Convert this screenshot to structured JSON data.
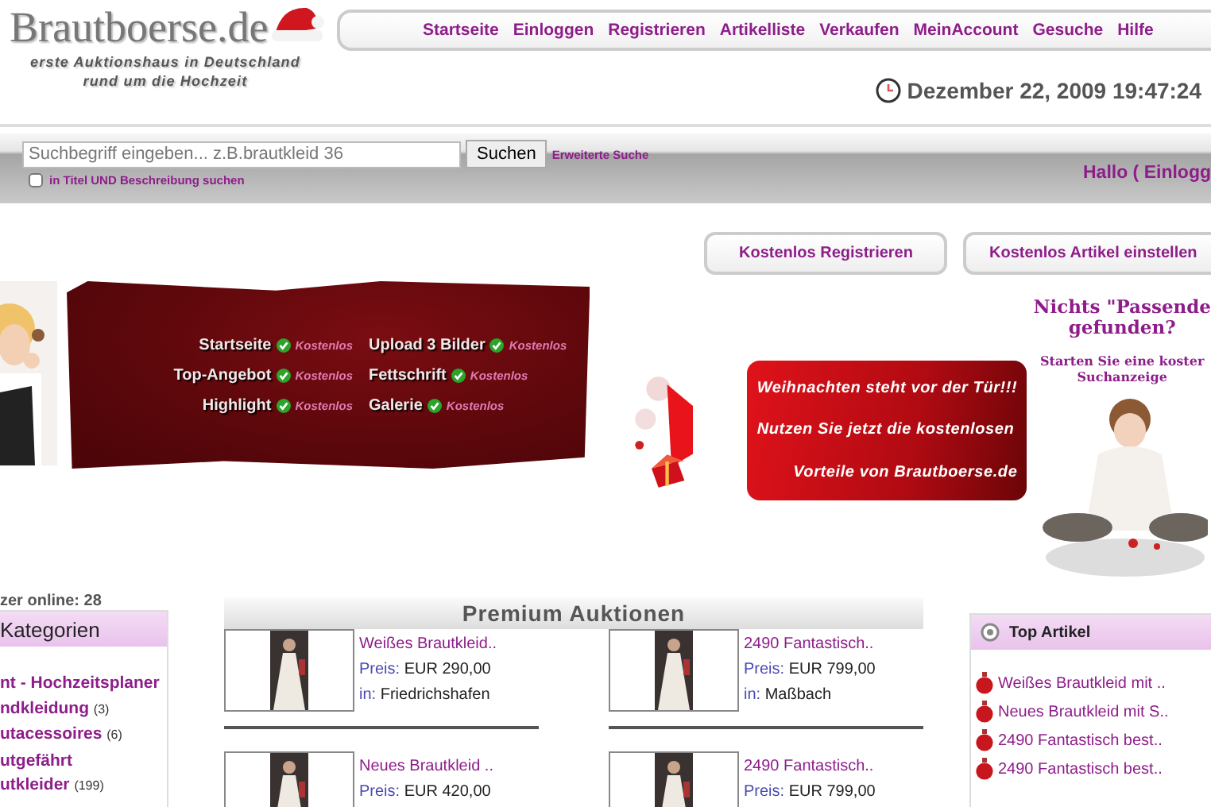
{
  "logo": {
    "title": "Brautboerse.de",
    "tagline": [
      "erste Auktionshaus in Deutschland",
      "rund um die Hochzeit"
    ]
  },
  "nav": [
    {
      "label": "Startseite"
    },
    {
      "label": "Einloggen"
    },
    {
      "label": "Registrieren"
    },
    {
      "label": "Artikelliste"
    },
    {
      "label": "Verkaufen"
    },
    {
      "label": "MeinAccount"
    },
    {
      "label": "Gesuche"
    },
    {
      "label": "Hilfe"
    }
  ],
  "datetime": "Dezember 22, 2009 19:47:24",
  "search": {
    "placeholder": "Suchbegriff eingeben... z.B.brautkleid 36",
    "button": "Suchen",
    "advanced_link": "Erweiterte Suche",
    "option": {
      "label": "in Titel UND Beschreibung suchen",
      "checked": false
    }
  },
  "greeting": "Hallo ( Einlogg",
  "action_buttons": [
    "Kostenlos Registrieren",
    "Kostenlos Artikel einstellen"
  ],
  "promo_banner": {
    "features": [
      {
        "label": "Startseite",
        "badge": "Kostenlos"
      },
      {
        "label": "Upload 3 Bilder",
        "badge": "Kostenlos"
      },
      {
        "label": "Top-Angebot",
        "badge": "Kostenlos"
      },
      {
        "label": "Fettschrift",
        "badge": "Kostenlos"
      },
      {
        "label": "Highlight",
        "badge": "Kostenlos"
      },
      {
        "label": "Galerie",
        "badge": "Kostenlos"
      }
    ]
  },
  "christmas_banner": {
    "lines": [
      "Weihnachten steht vor der Tür!!!",
      "Nutzen Sie jetzt die kostenlosen",
      "Vorteile von Brautboerse.de"
    ]
  },
  "search_request": {
    "heading": [
      "Nichts \"Passende",
      "gefunden?"
    ],
    "text": [
      "Starten Sie eine koster",
      "Suchanzeige"
    ]
  },
  "users_online": "zer online: 28",
  "categories": {
    "title": "Kategorien",
    "items": [
      {
        "name": "nt - Hochzeitsplaner"
      },
      {
        "name": "ndkleidung",
        "count": "(3)"
      },
      {
        "name": "utacessoires",
        "count": "(6)"
      },
      {
        "name": "utgefährt"
      },
      {
        "name": "utkleider",
        "count": "(199)"
      }
    ]
  },
  "premium": {
    "title": "Premium Auktionen",
    "items": [
      {
        "title": "Weißes Brautkleid..",
        "price_label": "Preis:",
        "price": "EUR 290,00",
        "location_label": "in:",
        "location": "Friedrichshafen"
      },
      {
        "title": "2490 Fantastisch..",
        "price_label": "Preis:",
        "price": "EUR 799,00",
        "location_label": "in:",
        "location": "Maßbach"
      },
      {
        "title": "Neues Brautkleid ..",
        "price_label": "Preis:",
        "price": "EUR 420,00"
      },
      {
        "title": "2490 Fantastisch..",
        "price_label": "Preis:",
        "price": "EUR 799,00"
      }
    ]
  },
  "top_articles": {
    "title": "Top Artikel",
    "items": [
      "Weißes Brautkleid mit ..",
      "Neues Brautkleid mit S..",
      "2490 Fantastisch best..",
      "2490 Fantastisch best.."
    ]
  }
}
